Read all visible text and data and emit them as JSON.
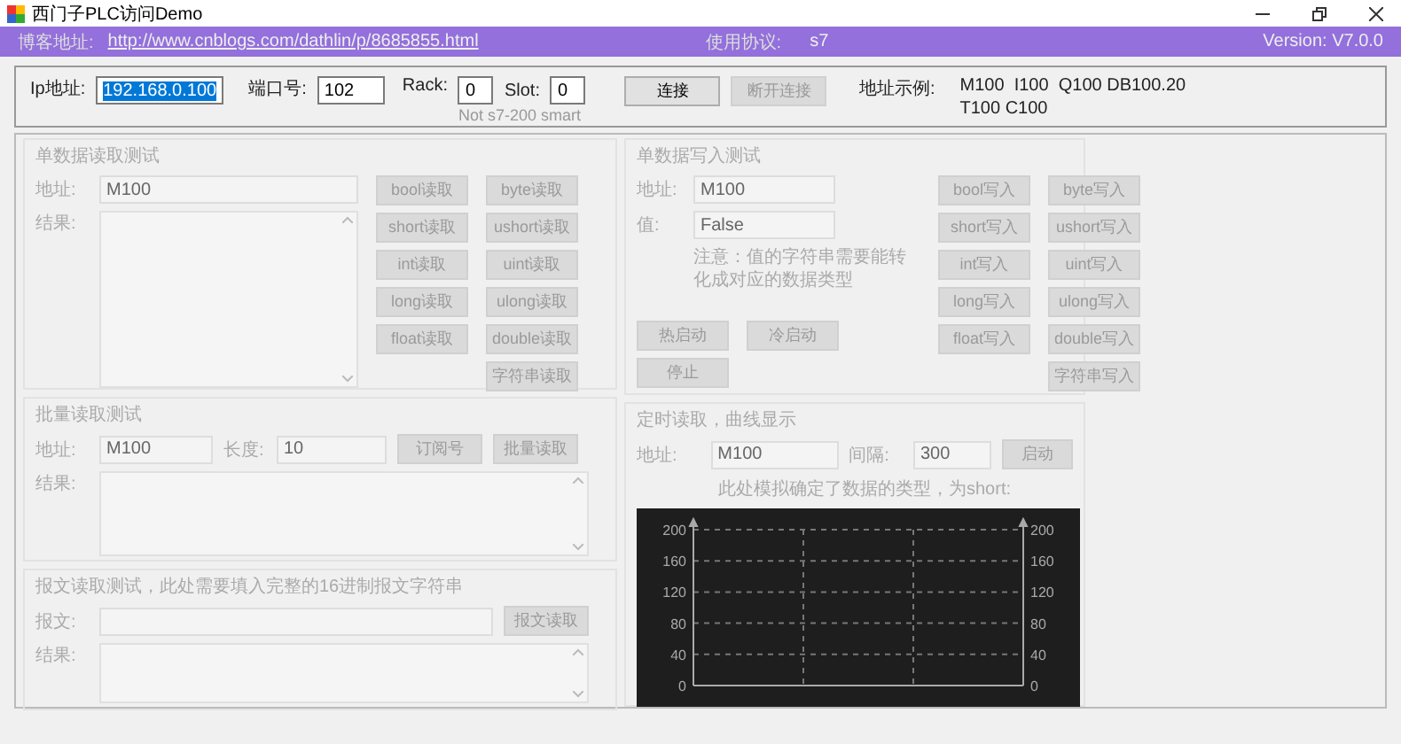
{
  "window": {
    "title": "西门子PLC访问Demo"
  },
  "info_bar": {
    "blog_label": "博客地址:",
    "blog_link": "http://www.cnblogs.com/dathlin/p/8685855.html",
    "protocol_label": "使用协议:",
    "protocol": "s7",
    "version": "Version: V7.0.0"
  },
  "connection": {
    "ip_label": "Ip地址:",
    "ip": "192.168.0.100",
    "ip_highlighted": true,
    "port_label": "端口号:",
    "port": "102",
    "rack_label": "Rack:",
    "rack": "0",
    "slot_label": "Slot:",
    "slot": "0",
    "hint": "Not s7-200 smart",
    "buttons": [
      {
        "label": "连接",
        "disabled": false
      },
      {
        "label": "断开连接",
        "disabled": true
      }
    ],
    "example_label": "地址示例:",
    "example_lines": [
      "M100  I100  Q100 DB100.20",
      "T100 C100"
    ]
  },
  "single_read": {
    "title": "单数据读取测试",
    "address_label": "地址:",
    "address": "M100",
    "result_label": "结果:",
    "buttons": [
      {
        "label": "bool读取",
        "disabled": true
      },
      {
        "label": "byte读取",
        "disabled": true
      },
      {
        "label": "short读取",
        "disabled": true
      },
      {
        "label": "ushort读取",
        "disabled": true
      },
      {
        "label": "int读取",
        "disabled": true
      },
      {
        "label": "uint读取",
        "disabled": true
      },
      {
        "label": "long读取",
        "disabled": true
      },
      {
        "label": "ulong读取",
        "disabled": true
      },
      {
        "label": "float读取",
        "disabled": true
      },
      {
        "label": "double读取",
        "disabled": true
      },
      {
        "label": "字符串读取",
        "disabled": true
      }
    ]
  },
  "single_write": {
    "title": "单数据写入测试",
    "address_label": "地址:",
    "address": "M100",
    "value_label": "值:",
    "value": "False",
    "note": "注意：值的字符串需要能转化成对应的数据类型",
    "control_buttons": [
      {
        "label": "热启动",
        "disabled": true
      },
      {
        "label": "冷启动",
        "disabled": true
      },
      {
        "label": "停止",
        "disabled": true
      }
    ],
    "buttons": [
      {
        "label": "bool写入",
        "disabled": true
      },
      {
        "label": "byte写入",
        "disabled": true
      },
      {
        "label": "short写入",
        "disabled": true
      },
      {
        "label": "ushort写入",
        "disabled": true
      },
      {
        "label": "int写入",
        "disabled": true
      },
      {
        "label": "uint写入",
        "disabled": true
      },
      {
        "label": "long写入",
        "disabled": true
      },
      {
        "label": "ulong写入",
        "disabled": true
      },
      {
        "label": "float写入",
        "disabled": true
      },
      {
        "label": "double写入",
        "disabled": true
      },
      {
        "label": "字符串写入",
        "disabled": true
      }
    ]
  },
  "batch_read": {
    "title": "批量读取测试",
    "address_label": "地址:",
    "address": "M100",
    "length_label": "长度:",
    "length": "10",
    "buttons": [
      {
        "label": "订阅号",
        "disabled": true
      },
      {
        "label": "批量读取",
        "disabled": true
      }
    ],
    "result_label": "结果:"
  },
  "message_read": {
    "title": "报文读取测试，此处需要填入完整的16进制报文字符串",
    "message_label": "报文:",
    "button": {
      "label": "报文读取",
      "disabled": true
    },
    "result_label": "结果:"
  },
  "timed_read": {
    "title": "定时读取，曲线显示",
    "address_label": "地址:",
    "address": "M100",
    "interval_label": "间隔:",
    "interval": "300",
    "button": {
      "label": "启动",
      "disabled": true
    },
    "note": "此处模拟确定了数据的类型，为short:",
    "plot": {
      "left_axis_labels": [
        "200",
        "160",
        "120",
        "80",
        "40",
        "0"
      ],
      "right_axis_labels": [
        "200",
        "160",
        "120",
        "80",
        "40",
        "0"
      ]
    }
  }
}
